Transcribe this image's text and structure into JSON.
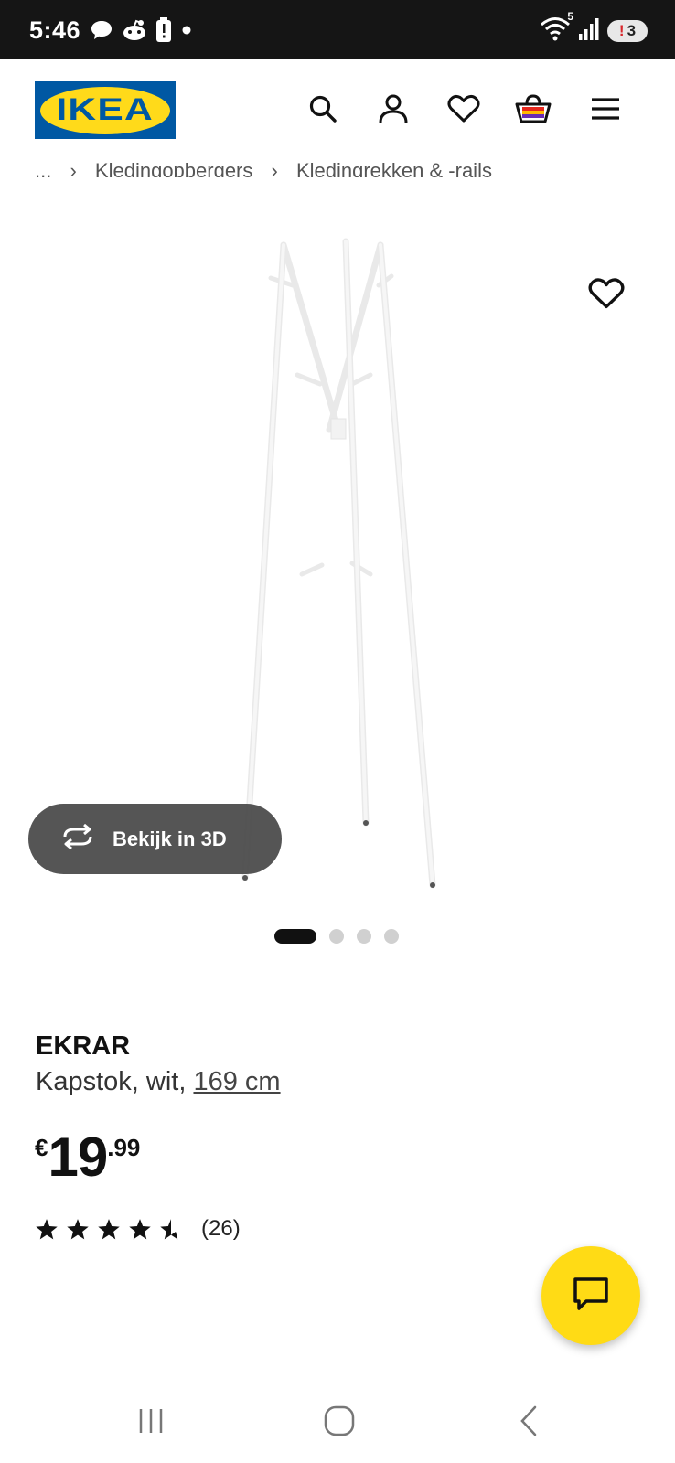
{
  "status_bar": {
    "time": "5:46",
    "left_icons": [
      "chat-bubble-icon",
      "reddit-icon",
      "battery-alert-icon",
      "dot-icon"
    ],
    "right_icons": [
      "wifi-icon",
      "signal-icon"
    ],
    "network_label": "5",
    "notification_count": "3"
  },
  "header": {
    "logo_text": "IKEA",
    "icons": [
      "search-icon",
      "account-icon",
      "wishlist-heart-icon",
      "shopping-bag-icon",
      "menu-icon"
    ],
    "brand_blue": "#0058a3",
    "brand_yellow": "#ffda1a"
  },
  "breadcrumb": {
    "items": [
      "...",
      "Kledingopbergers",
      "Kledingrekken & -rails"
    ],
    "separator": "›"
  },
  "gallery": {
    "view_3d_label": "Bekijk in 3D",
    "image_count": 4,
    "active_index": 0
  },
  "product": {
    "name": "EKRAR",
    "description_prefix": "Kapstok, wit, ",
    "size": "169 cm",
    "price_currency": "€",
    "price_int": "19",
    "price_dec": ".99",
    "rating_value": 4.5,
    "rating_max": 5,
    "review_count": "(26)"
  },
  "chat": {
    "icon": "chat-icon",
    "color": "#ffdb15"
  },
  "navbar": {
    "icons": [
      "recent-apps-icon",
      "home-icon",
      "back-icon"
    ]
  }
}
